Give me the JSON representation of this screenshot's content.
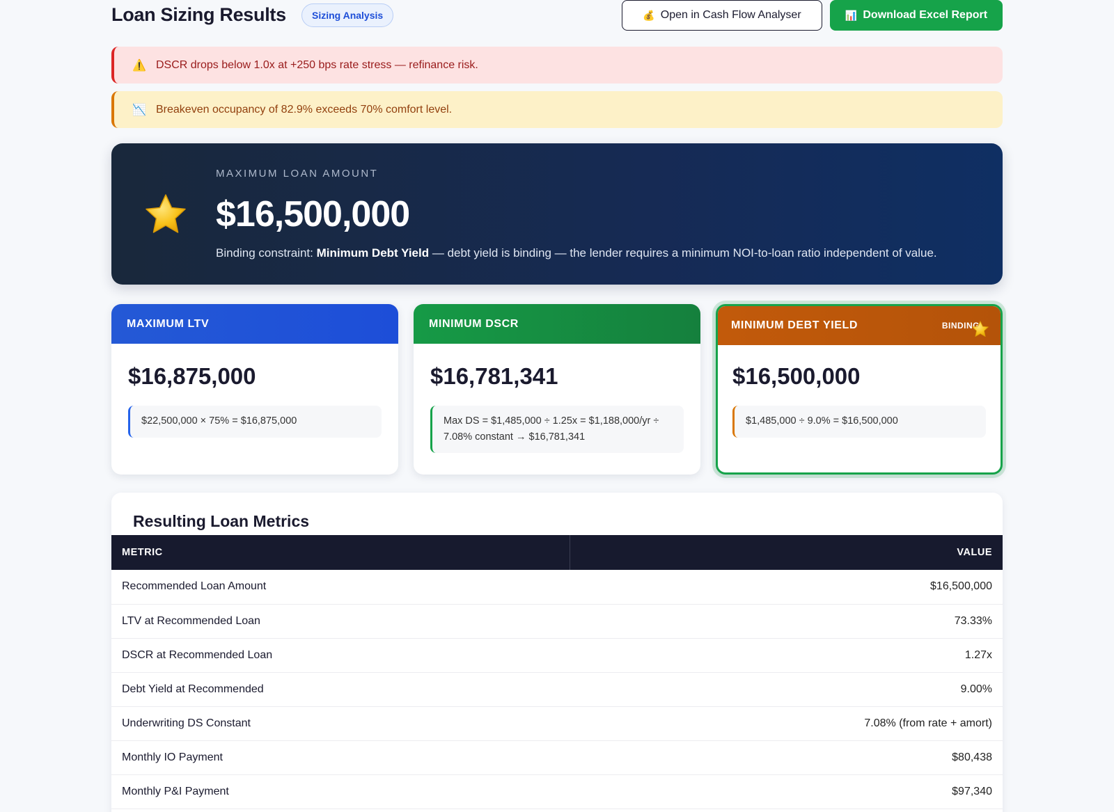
{
  "header": {
    "title": "Loan Sizing Results",
    "tag": "Sizing Analysis",
    "open_cash_flow_label": "Open in Cash Flow Analyser",
    "download_excel_label": "Download Excel Report",
    "open_cash_flow_icon": "money-bag-icon",
    "download_excel_icon": "chart-icon"
  },
  "alerts": [
    {
      "icon": "warning-icon",
      "text": "DSCR drops below 1.0x at +250 bps rate stress — refinance risk."
    },
    {
      "icon": "chart-down-icon",
      "text": "Breakeven occupancy of 82.9% exceeds 70% comfort level."
    }
  ],
  "hero": {
    "label": "MAXIMUM LOAN AMOUNT",
    "amount": "$16,500,000",
    "sub_prefix": "Binding constraint: ",
    "sub_bold": "Minimum Debt Yield",
    "sub_rest": " — debt yield is binding — the lender requires a minimum NOI-to-loan ratio independent of value."
  },
  "cards": [
    {
      "title": "MAXIMUM LTV",
      "amount": "$16,875,000",
      "formula": "$22,500,000 × 75% = $16,875,000"
    },
    {
      "title": "MINIMUM DSCR",
      "amount": "$16,781,341",
      "formula": "Max DS = $1,485,000 ÷ 1.25x = $1,188,000/yr ÷ 7.08% constant → $16,781,341"
    },
    {
      "title": "MINIMUM DEBT YIELD",
      "amount": "$16,500,000",
      "formula": "$1,485,000 ÷ 9.0% = $16,500,000",
      "badge": "BINDING"
    }
  ],
  "metrics": {
    "title": "Resulting Loan Metrics",
    "columns": [
      "METRIC",
      "VALUE"
    ],
    "rows": [
      {
        "metric": "Recommended Loan Amount",
        "value": "$16,500,000"
      },
      {
        "metric": "LTV at Recommended Loan",
        "value": "73.33%"
      },
      {
        "metric": "DSCR at Recommended Loan",
        "value": "1.27x"
      },
      {
        "metric": "Debt Yield at Recommended",
        "value": "9.00%"
      },
      {
        "metric": "Underwriting DS Constant",
        "value": "7.08% (from rate + amort)"
      },
      {
        "metric": "Monthly IO Payment",
        "value": "$80,438"
      },
      {
        "metric": "Monthly P&I Payment",
        "value": "$97,340"
      }
    ]
  },
  "colors": {
    "ltv": "#1d4ed8",
    "dscr": "#15803d",
    "debt_yield": "#b45309",
    "binding_border": "#16a34a",
    "hero_bg": "#162a54"
  }
}
